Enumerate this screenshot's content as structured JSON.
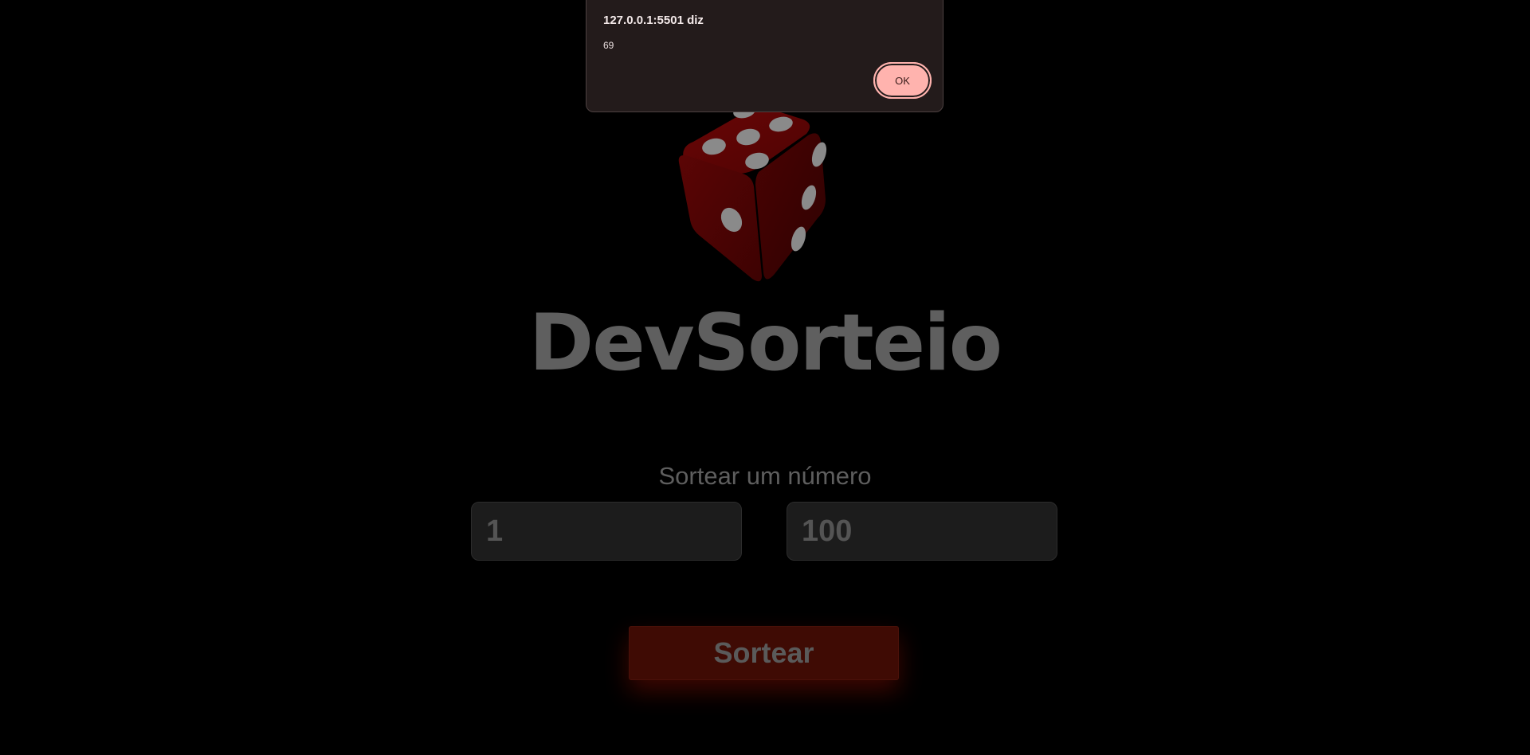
{
  "app": {
    "title": "DevSorteio",
    "subtitle": "Sortear um número"
  },
  "logo": {
    "icon": "dice-icon",
    "color": "#7a0a0a"
  },
  "inputs": {
    "min_placeholder": "1",
    "max_placeholder": "100"
  },
  "draw_button": {
    "label": "Sortear"
  },
  "alert": {
    "title": "127.0.0.1:5501 diz",
    "message": "69",
    "ok_label": "OK"
  },
  "colors": {
    "background": "#000000",
    "button": "#3f0b04",
    "alert_bg": "#231b1b",
    "alert_button": "#ffb3ae"
  }
}
